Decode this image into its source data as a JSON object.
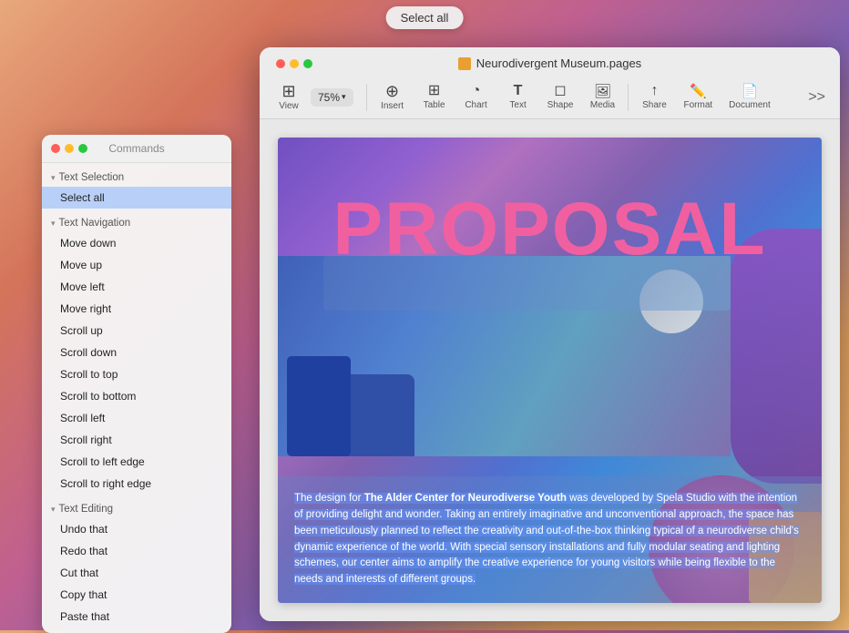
{
  "select_all_btn": "Select all",
  "commands_panel": {
    "title": "Commands",
    "sections": [
      {
        "id": "text-selection",
        "label": "Text Selection",
        "items": [
          "Select all"
        ]
      },
      {
        "id": "text-navigation",
        "label": "Text Navigation",
        "items": [
          "Move down",
          "Move up",
          "Move left",
          "Move right",
          "Scroll up",
          "Scroll down",
          "Scroll to top",
          "Scroll to bottom",
          "Scroll left",
          "Scroll right",
          "Scroll to left edge",
          "Scroll to right edge"
        ]
      },
      {
        "id": "text-editing",
        "label": "Text Editing",
        "items": [
          "Undo that",
          "Redo that",
          "Cut that",
          "Copy that",
          "Paste that"
        ]
      }
    ]
  },
  "app": {
    "title": "Neurodivergent Museum.pages",
    "toolbar": {
      "zoom": "75%",
      "items": [
        {
          "id": "view",
          "label": "View",
          "icon": "⊞"
        },
        {
          "id": "insert",
          "label": "Insert",
          "icon": "⊕"
        },
        {
          "id": "table",
          "label": "Table",
          "icon": "⊞"
        },
        {
          "id": "chart",
          "label": "Chart",
          "icon": "◔"
        },
        {
          "id": "text",
          "label": "Text",
          "icon": "T"
        },
        {
          "id": "shape",
          "label": "Shape",
          "icon": "◻"
        },
        {
          "id": "media",
          "label": "Media",
          "icon": "⬛"
        },
        {
          "id": "share",
          "label": "Share",
          "icon": "↑"
        },
        {
          "id": "format",
          "label": "Format",
          "icon": "✏"
        },
        {
          "id": "document",
          "label": "Document",
          "icon": "📄"
        }
      ]
    }
  },
  "document": {
    "proposal_text": "PROPOSAL",
    "body_text": "The design for The Alder Center for Neurodiverse Youth was developed by Spela Studio with the intention of providing delight and wonder. Taking an entirely imaginative and unconventional approach, the space has been meticulously planned to reflect the creativity and out-of-the-box thinking typical of a neurodiverse child's dynamic experience of the world. With special sensory installations and fully modular seating and lighting schemes, our center aims to amplify the creative experience for young visitors while being flexible to the needs and interests of different groups."
  }
}
